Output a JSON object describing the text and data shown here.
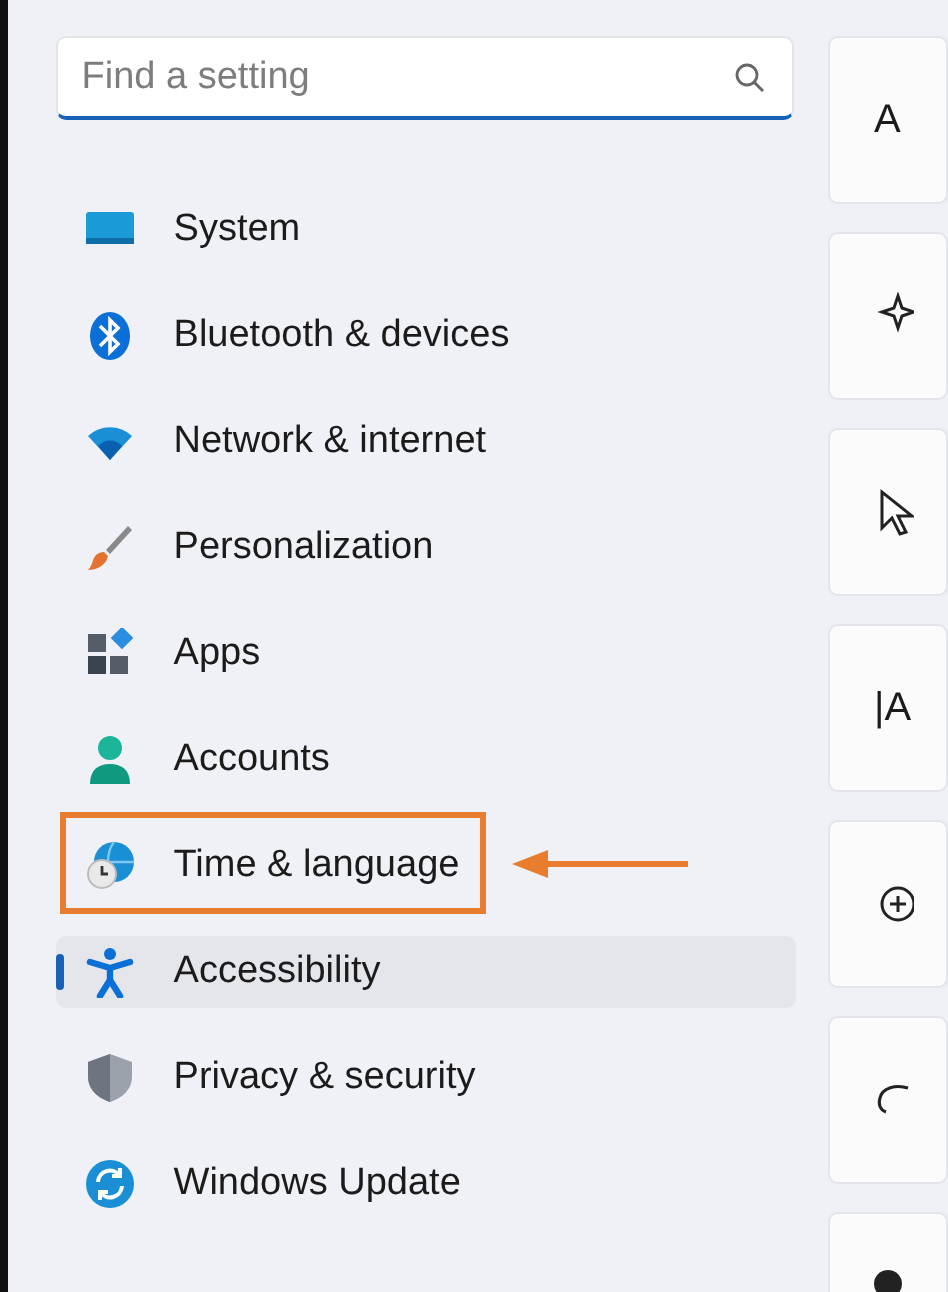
{
  "search": {
    "placeholder": "Find a setting"
  },
  "nav": [
    {
      "label": "System",
      "kind": "system",
      "selected": false,
      "annotated": false
    },
    {
      "label": "Bluetooth & devices",
      "kind": "bluetooth",
      "selected": false,
      "annotated": false
    },
    {
      "label": "Network & internet",
      "kind": "network",
      "selected": false,
      "annotated": false
    },
    {
      "label": "Personalization",
      "kind": "brush",
      "selected": false,
      "annotated": false
    },
    {
      "label": "Apps",
      "kind": "apps",
      "selected": false,
      "annotated": false
    },
    {
      "label": "Accounts",
      "kind": "accounts",
      "selected": false,
      "annotated": false
    },
    {
      "label": "Time & language",
      "kind": "time",
      "selected": false,
      "annotated": true
    },
    {
      "label": "Accessibility",
      "kind": "accessibility",
      "selected": true,
      "annotated": false
    },
    {
      "label": "Privacy & security",
      "kind": "shield",
      "selected": false,
      "annotated": false
    },
    {
      "label": "Windows Update",
      "kind": "update",
      "selected": false,
      "annotated": false
    }
  ],
  "cards": [
    {
      "kind": "text",
      "text": "A"
    },
    {
      "kind": "sparkle"
    },
    {
      "kind": "cursor"
    },
    {
      "kind": "text",
      "text": "|A"
    },
    {
      "kind": "zoom"
    },
    {
      "kind": "bubble"
    },
    {
      "kind": "dot"
    }
  ]
}
